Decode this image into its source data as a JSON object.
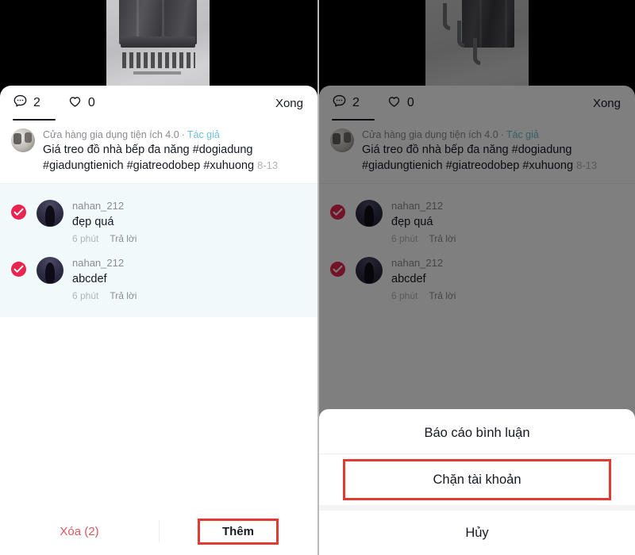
{
  "colors": {
    "accent_red": "#e8244f",
    "highlight_border": "#e03a33",
    "delete_text": "#d9595e",
    "selection_bg": "#f1fafb",
    "author_tag": "#6cc1d4",
    "dim_overlay": "rgba(0,0,0,0.5)"
  },
  "panel": {
    "tabs": [
      {
        "icon": "comment-bubble-icon",
        "count": "2",
        "active": true
      },
      {
        "icon": "heart-icon",
        "count": "0",
        "active": false
      }
    ],
    "done_label": "Xong",
    "post": {
      "author": "Cửa hàng gia dụng tiện ích 4.0",
      "separator": "·",
      "author_badge": "Tác giả",
      "caption": "Giá treo đồ nhà bếp đa năng #dogiadung #giadungtienich #giatreodobep #xuhuong",
      "date": "8-13"
    },
    "comments": [
      {
        "selected": true,
        "username": "nahan_212",
        "text": "đẹp quá",
        "time": "6 phút",
        "reply_label": "Trả lời"
      },
      {
        "selected": true,
        "username": "nahan_212",
        "text": "abcdef",
        "time": "6 phút",
        "reply_label": "Trả lời"
      }
    ],
    "bottom_bar": {
      "delete_label": "Xóa (2)",
      "add_label": "Thêm"
    }
  },
  "action_sheet": {
    "items": [
      {
        "label": "Báo cáo bình luận",
        "highlighted": false
      },
      {
        "label": "Chặn tài khoản",
        "highlighted": true
      },
      {
        "label": "Hủy",
        "highlighted": false
      }
    ]
  }
}
